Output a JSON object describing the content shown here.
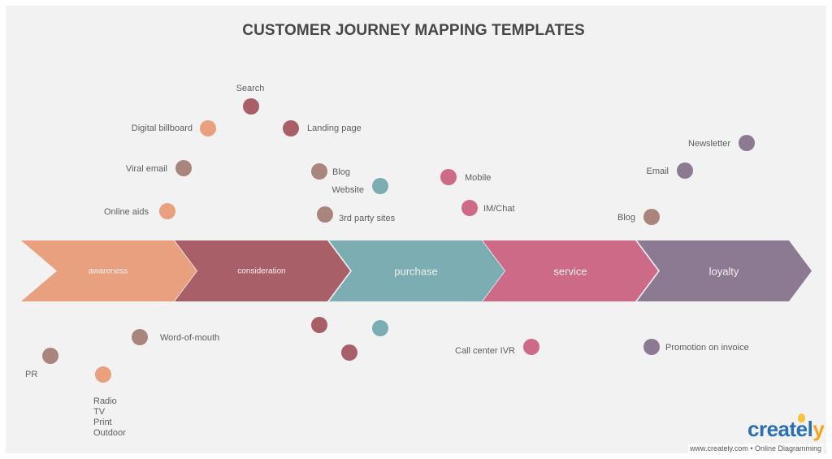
{
  "title": "CUSTOMER JOURNEY MAPPING TEMPLATES",
  "colors": {
    "awareness": "#e8a07e",
    "consideration": "#a85f68",
    "purchase": "#7badb2",
    "service": "#cc6a88",
    "loyalty": "#8c7a93",
    "neutral": "#a9857d"
  },
  "stages": [
    {
      "id": "awareness",
      "label": "awareness",
      "color": "#e8a07e"
    },
    {
      "id": "consideration",
      "label": "consideration",
      "color": "#a85f68"
    },
    {
      "id": "purchase",
      "label": "purchase",
      "color": "#7badb2"
    },
    {
      "id": "service",
      "label": "service",
      "color": "#cc6a88"
    },
    {
      "id": "loyalty",
      "label": "loyalty",
      "color": "#8c7a93"
    }
  ],
  "touchpoints_above": [
    {
      "label": "Search",
      "color": "#a85f68"
    },
    {
      "label": "Digital billboard",
      "color": "#e8a07e"
    },
    {
      "label": "Landing page",
      "color": "#a85f68"
    },
    {
      "label": "Viral email",
      "color": "#a9857d"
    },
    {
      "label": "Blog",
      "color": "#a9857d"
    },
    {
      "label": "Website",
      "color": "#7badb2"
    },
    {
      "label": "Online aids",
      "color": "#e8a07e"
    },
    {
      "label": "3rd party sites",
      "color": "#a9857d"
    },
    {
      "label": "Mobile",
      "color": "#cc6a88"
    },
    {
      "label": "IM/Chat",
      "color": "#cc6a88"
    },
    {
      "label": "Newsletter",
      "color": "#8c7a93"
    },
    {
      "label": "Email",
      "color": "#8c7a93"
    },
    {
      "label": "Blog",
      "color": "#a9857d"
    }
  ],
  "touchpoints_below": [
    {
      "label": "Word-of-mouth",
      "color": "#a9857d"
    },
    {
      "label": "PR",
      "color": "#a9857d"
    },
    {
      "label": "Radio",
      "color": "#e8a07e",
      "extra": [
        "TV",
        "Print",
        "Outdoor"
      ]
    },
    {
      "label": "",
      "color": "#a85f68"
    },
    {
      "label": "",
      "color": "#7badb2"
    },
    {
      "label": "",
      "color": "#a85f68"
    },
    {
      "label": "Call center IVR",
      "color": "#cc6a88"
    },
    {
      "label": "Promotion on invoice",
      "color": "#8c7a93"
    }
  ],
  "branding": {
    "logo_main": "creat",
    "logo_tail": "ely",
    "footer": "www.creately.com • Online Diagramming"
  }
}
